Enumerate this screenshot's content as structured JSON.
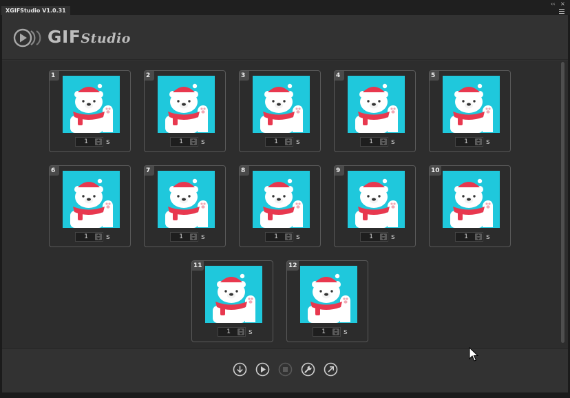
{
  "app": {
    "title": "XGIFStudio V1.0.31"
  },
  "window_controls": {
    "collapse": "‹‹",
    "close": "×"
  },
  "logo": {
    "text": "GIF",
    "text_script": "Studio"
  },
  "frames": [
    {
      "number": "1",
      "duration": "1",
      "unit": "s"
    },
    {
      "number": "2",
      "duration": "1",
      "unit": "s"
    },
    {
      "number": "3",
      "duration": "1",
      "unit": "s"
    },
    {
      "number": "4",
      "duration": "1",
      "unit": "s"
    },
    {
      "number": "5",
      "duration": "1",
      "unit": "s"
    },
    {
      "number": "6",
      "duration": "1",
      "unit": "s"
    },
    {
      "number": "7",
      "duration": "1",
      "unit": "s"
    },
    {
      "number": "8",
      "duration": "1",
      "unit": "s"
    },
    {
      "number": "9",
      "duration": "1",
      "unit": "s"
    },
    {
      "number": "10",
      "duration": "1",
      "unit": "s"
    },
    {
      "number": "11",
      "duration": "1",
      "unit": "s"
    },
    {
      "number": "12",
      "duration": "1",
      "unit": "s"
    }
  ],
  "toolbar": {
    "icons": [
      "download-icon",
      "play-icon",
      "stop-icon",
      "settings-wrench-icon",
      "export-icon"
    ],
    "stop_enabled": false
  },
  "colors": {
    "thumbnail_background": "#1fc8dc",
    "scarf": "#e8384f",
    "hat": "#e8384f"
  }
}
